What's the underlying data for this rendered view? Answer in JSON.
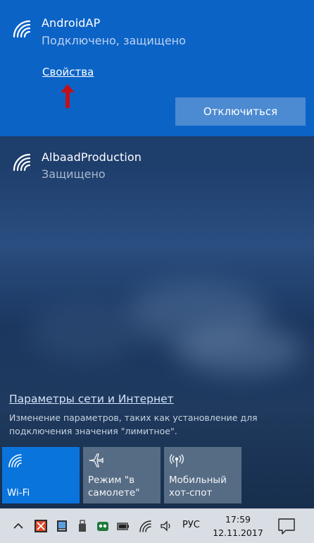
{
  "networks": {
    "active": {
      "name": "AndroidAP",
      "status": "Подключено, защищено",
      "properties_link": "Свойства",
      "disconnect_label": "Отключиться"
    },
    "other": {
      "name": "AlbaadProduction",
      "status": "Защищено"
    }
  },
  "settings": {
    "link": "Параметры сети и Интернет",
    "description": "Изменение параметров, таких как установление для подключения значения \"лимитное\"."
  },
  "quick_actions": [
    {
      "label": "Wi-Fi",
      "icon": "wifi-icon",
      "state": "on"
    },
    {
      "label": "Режим \"в\nсамолете\"",
      "icon": "airplane-icon",
      "state": "off"
    },
    {
      "label": "Мобильный\nхот-спот",
      "icon": "hotspot-icon",
      "state": "off"
    }
  ],
  "taskbar": {
    "language": "РУС",
    "time": "17:59",
    "date": "12.11.2017"
  },
  "colors": {
    "accent": "#0c63c6",
    "button": "#4c8ad2",
    "tile_on": "#0a74dd",
    "arrow": "#c0111b"
  }
}
